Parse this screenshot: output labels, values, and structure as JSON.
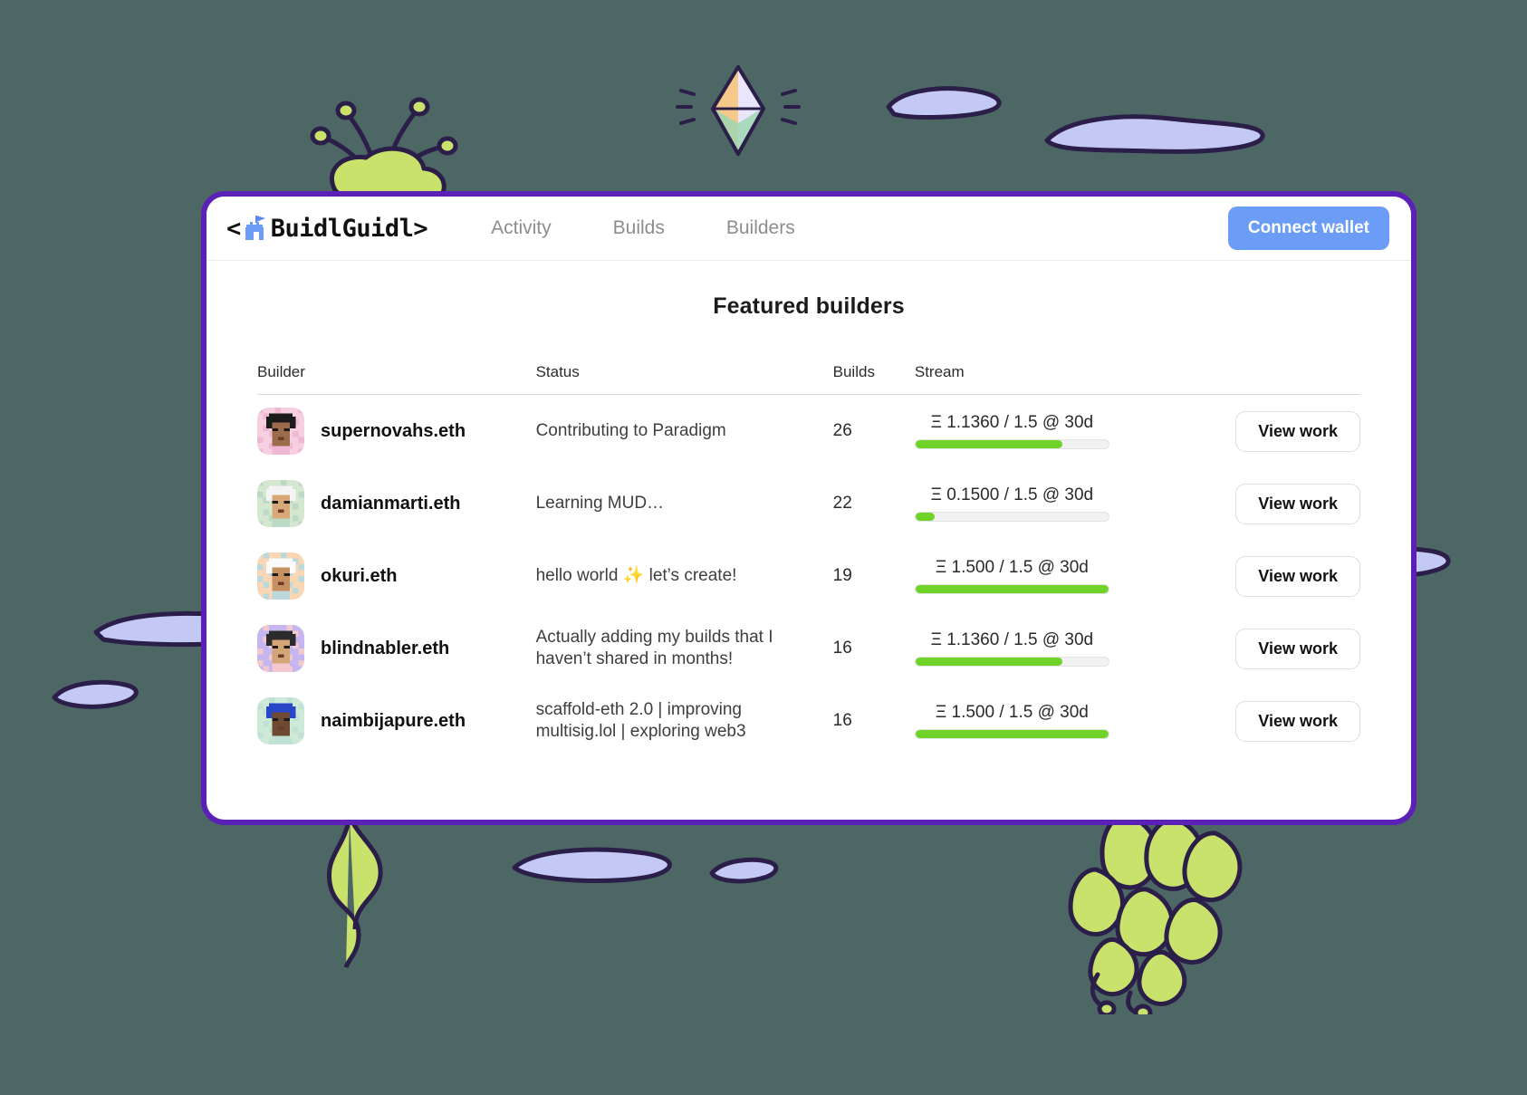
{
  "theme": {
    "page_background": "#4c6764",
    "card_border": "#5b21b6",
    "accent_blue": "#6b9df7",
    "progress_green": "#6fd32a",
    "doodle_cloud": "#c3c8f5",
    "doodle_leaf": "#c9e26b",
    "doodle_outline": "#2b1f4a"
  },
  "header": {
    "logo": {
      "prefix": "<",
      "icon": "castle-icon",
      "text_parts": [
        {
          "t": "Bui",
          "accent": false
        },
        {
          "t": "dl",
          "accent": true
        },
        {
          "t": "Gui",
          "accent": false
        },
        {
          "t": "dl",
          "accent": true
        }
      ],
      "suffix": ">",
      "full_text": "<BuidlGuidl>"
    },
    "nav": [
      {
        "label": "Activity",
        "name": "nav-activity"
      },
      {
        "label": "Builds",
        "name": "nav-builds"
      },
      {
        "label": "Builders",
        "name": "nav-builders"
      }
    ],
    "connect_wallet_label": "Connect wallet"
  },
  "main": {
    "title": "Featured builders",
    "columns": [
      "Builder",
      "Status",
      "Builds",
      "Stream"
    ],
    "action_label": "View work",
    "rows": [
      {
        "builder": "supernovahs.eth",
        "status": "Contributing to Paradigm",
        "builds": "26",
        "stream_label": "Ξ 1.1360 / 1.5 @ 30d",
        "stream_value": 1.136,
        "stream_cap": 1.5,
        "stream_period": "30d",
        "progress_pct": 76,
        "avatar": {
          "bg": "#f6cfe0",
          "skin": "#9c6b4b",
          "hair": "#1b1b1b",
          "accent": "#f0b7d2"
        }
      },
      {
        "builder": "damianmarti.eth",
        "status": "Learning MUD…",
        "builds": "22",
        "stream_label": "Ξ 0.1500 / 1.5 @ 30d",
        "stream_value": 0.15,
        "stream_cap": 1.5,
        "stream_period": "30d",
        "progress_pct": 10,
        "avatar": {
          "bg": "#d6e7cf",
          "skin": "#d8a878",
          "hair": "#f4f4f4",
          "accent": "#bcd9c6"
        }
      },
      {
        "builder": "okuri.eth",
        "status": "hello world ✨ let’s create!",
        "builds": "19",
        "stream_label": "Ξ 1.500 / 1.5 @ 30d",
        "stream_value": 1.5,
        "stream_cap": 1.5,
        "stream_period": "30d",
        "progress_pct": 100,
        "avatar": {
          "bg": "#f9d7b5",
          "skin": "#c79060",
          "hair": "#fbfbfb",
          "accent": "#bcd8dd"
        }
      },
      {
        "builder": "blindnabler.eth",
        "status": "Actually adding my builds that I haven’t shared in months!",
        "builds": "16",
        "stream_label": "Ξ 1.1360 / 1.5 @ 30d",
        "stream_value": 1.136,
        "stream_cap": 1.5,
        "stream_period": "30d",
        "progress_pct": 76,
        "avatar": {
          "bg": "#c6b6f0",
          "skin": "#d3a475",
          "hair": "#2b2b2b",
          "accent": "#f3c8cf"
        }
      },
      {
        "builder": "naimbijapure.eth",
        "status": "scaffold-eth 2.0 | improving multisig.lol | exploring web3",
        "builds": "16",
        "stream_label": "Ξ 1.500 / 1.5 @ 30d",
        "stream_value": 1.5,
        "stream_cap": 1.5,
        "stream_period": "30d",
        "progress_pct": 100,
        "avatar": {
          "bg": "#cfe9d9",
          "skin": "#6e4a33",
          "hair": "#2746c8",
          "accent": "#bfe2d4"
        }
      }
    ]
  },
  "decorations": {
    "clouds": 7,
    "plants": 2,
    "gem": "ethereum-diamond"
  }
}
